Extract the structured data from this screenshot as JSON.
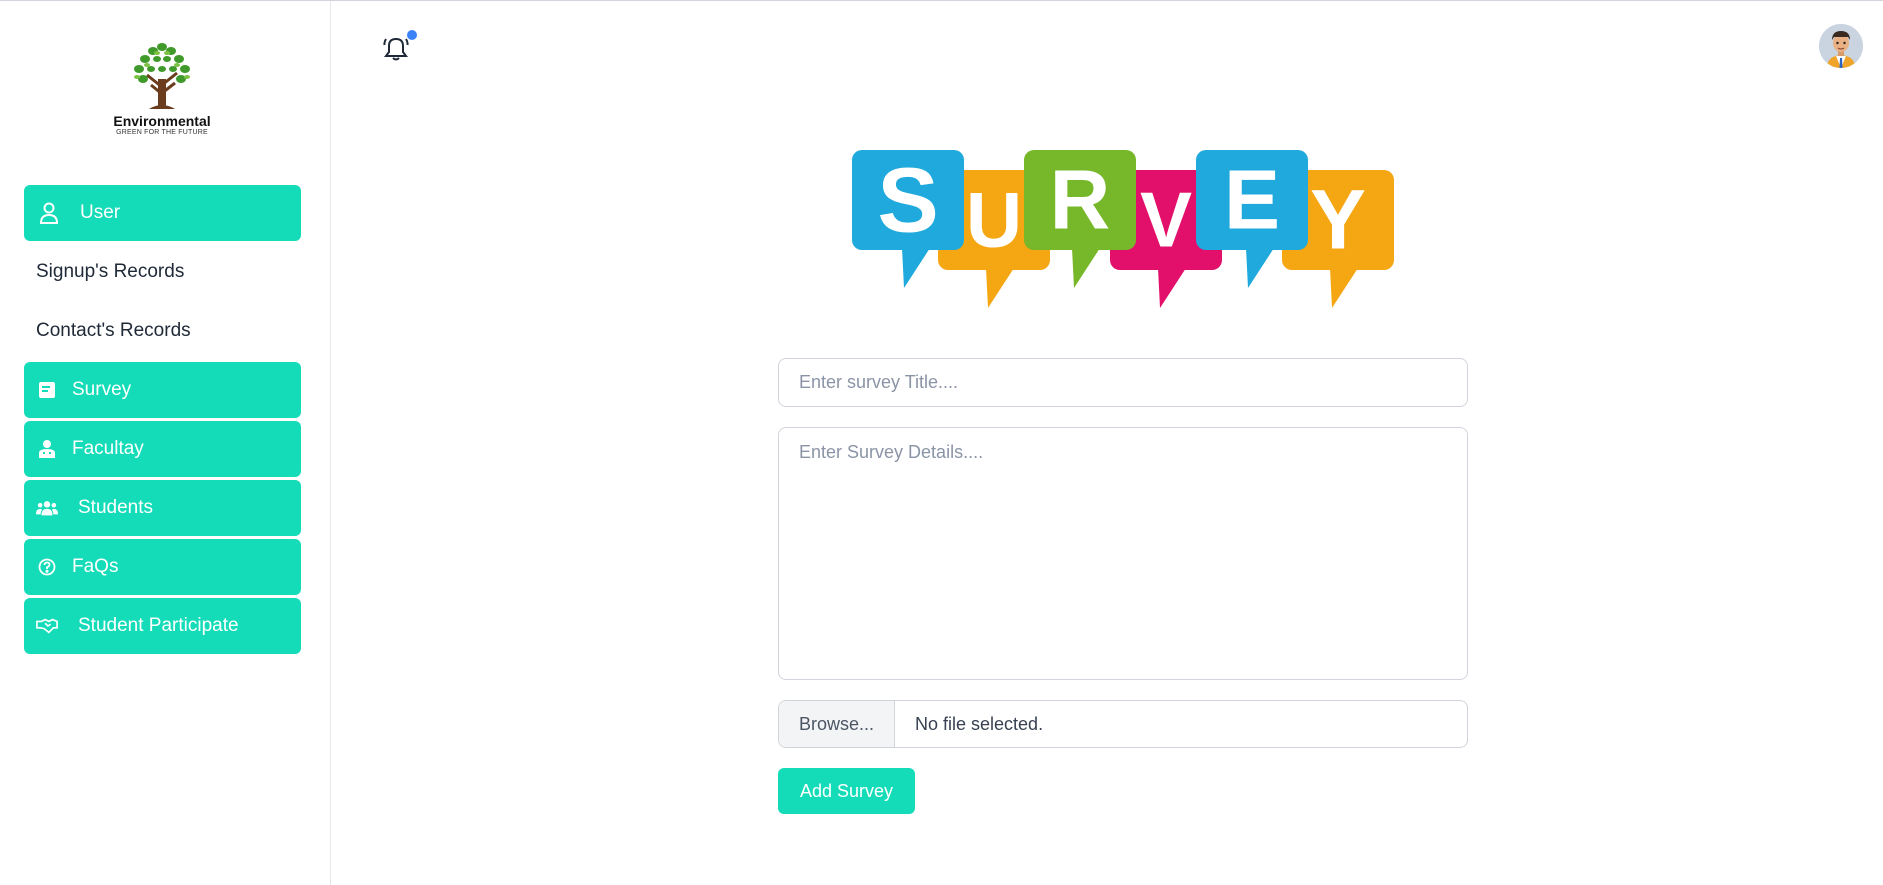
{
  "brand": {
    "name": "Environmental",
    "tagline": "GREEN FOR THE FUTURE"
  },
  "sidebar": {
    "items": [
      {
        "label": "User",
        "icon": "user-icon",
        "style": "active"
      },
      {
        "label": "Signup's Records",
        "style": "plain"
      },
      {
        "label": "Contact's Records",
        "style": "plain"
      },
      {
        "label": "Survey",
        "icon": "survey-icon",
        "style": "active"
      },
      {
        "label": "Facultay",
        "icon": "faculty-icon",
        "style": "active"
      },
      {
        "label": "Students",
        "icon": "students-icon",
        "style": "active"
      },
      {
        "label": "FaQs",
        "icon": "question-circle-icon",
        "style": "active"
      },
      {
        "label": "Student Participate",
        "icon": "handshake-icon",
        "style": "active"
      }
    ]
  },
  "banner": {
    "letters": [
      "S",
      "U",
      "R",
      "V",
      "E",
      "Y"
    ],
    "colors": [
      "#1fa9dc",
      "#f5a713",
      "#77b82a",
      "#e2106a",
      "#1fa9dc",
      "#f5a713"
    ]
  },
  "form": {
    "title_placeholder": "Enter survey Title....",
    "details_placeholder": "Enter Survey Details....",
    "browse_label": "Browse...",
    "file_status": "No file selected.",
    "submit_label": "Add Survey"
  },
  "colors": {
    "accent": "#14dcb8",
    "notification_dot": "#3b82f6"
  }
}
